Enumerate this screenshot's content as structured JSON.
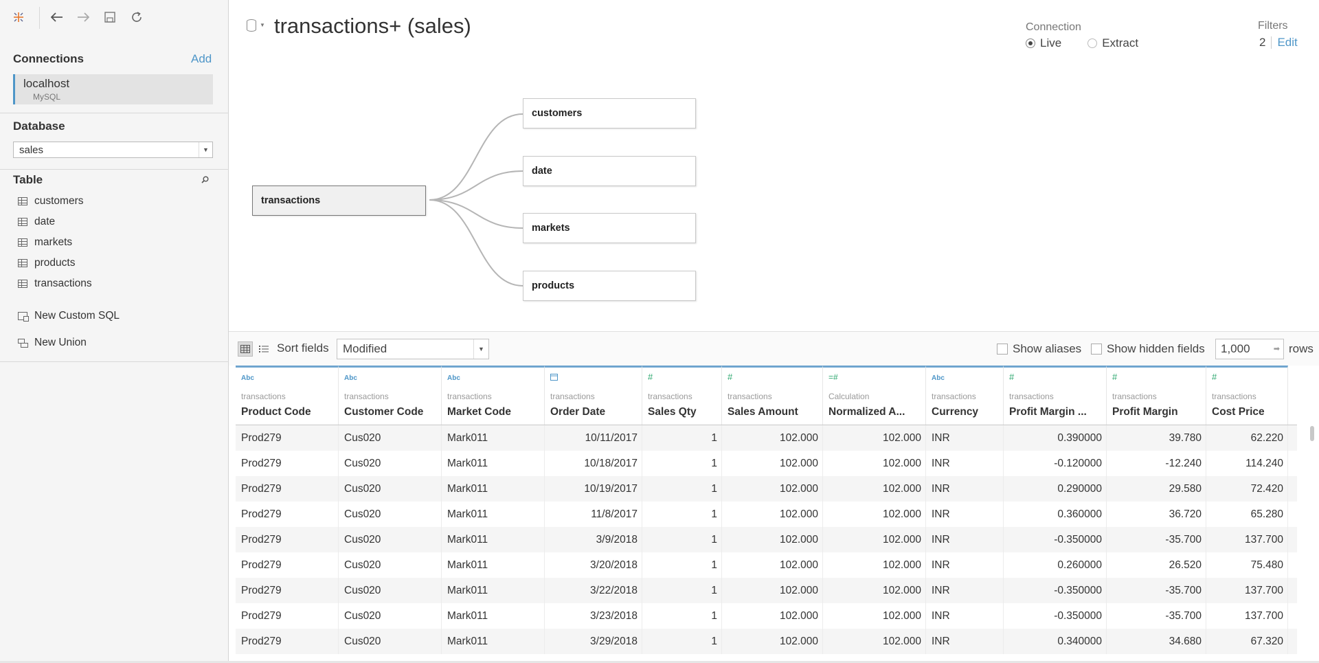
{
  "left": {
    "connections_title": "Connections",
    "add_label": "Add",
    "connection": {
      "name": "localhost",
      "type": "MySQL"
    },
    "database_title": "Database",
    "database_value": "sales",
    "table_title": "Table",
    "tables": [
      "customers",
      "date",
      "markets",
      "products",
      "transactions"
    ],
    "new_custom_sql": "New Custom SQL",
    "new_union": "New Union"
  },
  "header": {
    "datasource_title": "transactions+ (sales)",
    "connection_label": "Connection",
    "live_label": "Live",
    "extract_label": "Extract",
    "selected_connection": "Live",
    "filters_label": "Filters",
    "filters_count": "2",
    "edit_label": "Edit"
  },
  "canvas": {
    "main_table": "transactions",
    "joined_tables": [
      "customers",
      "date",
      "markets",
      "products"
    ]
  },
  "grid_toolbar": {
    "sort_label": "Sort fields",
    "sort_value": "Modified",
    "show_aliases": "Show aliases",
    "show_hidden": "Show hidden fields",
    "rows_value": "1,000",
    "rows_label": "rows"
  },
  "columns": [
    {
      "type": "Abc",
      "type_kind": "str",
      "source": "transactions",
      "name": "Product Code",
      "align": "l"
    },
    {
      "type": "Abc",
      "type_kind": "str",
      "source": "transactions",
      "name": "Customer Code",
      "align": "l"
    },
    {
      "type": "Abc",
      "type_kind": "str",
      "source": "transactions",
      "name": "Market Code",
      "align": "l"
    },
    {
      "type": "calendar",
      "type_kind": "date",
      "source": "transactions",
      "name": "Order Date",
      "align": "r"
    },
    {
      "type": "#",
      "type_kind": "num",
      "source": "transactions",
      "name": "Sales Qty",
      "align": "r"
    },
    {
      "type": "#",
      "type_kind": "num",
      "source": "transactions",
      "name": "Sales Amount",
      "align": "r"
    },
    {
      "type": "=#",
      "type_kind": "cal",
      "source": "Calculation",
      "name": "Normalized A...",
      "align": "r"
    },
    {
      "type": "Abc",
      "type_kind": "str",
      "source": "transactions",
      "name": "Currency",
      "align": "l"
    },
    {
      "type": "#",
      "type_kind": "num",
      "source": "transactions",
      "name": "Profit Margin ...",
      "align": "r"
    },
    {
      "type": "#",
      "type_kind": "num",
      "source": "transactions",
      "name": "Profit Margin",
      "align": "r"
    },
    {
      "type": "#",
      "type_kind": "num",
      "source": "transactions",
      "name": "Cost Price",
      "align": "r"
    }
  ],
  "rows": [
    [
      "Prod279",
      "Cus020",
      "Mark011",
      "10/11/2017",
      "1",
      "102.000",
      "102.000",
      "INR",
      "0.390000",
      "39.780",
      "62.220"
    ],
    [
      "Prod279",
      "Cus020",
      "Mark011",
      "10/18/2017",
      "1",
      "102.000",
      "102.000",
      "INR",
      "-0.120000",
      "-12.240",
      "114.240"
    ],
    [
      "Prod279",
      "Cus020",
      "Mark011",
      "10/19/2017",
      "1",
      "102.000",
      "102.000",
      "INR",
      "0.290000",
      "29.580",
      "72.420"
    ],
    [
      "Prod279",
      "Cus020",
      "Mark011",
      "11/8/2017",
      "1",
      "102.000",
      "102.000",
      "INR",
      "0.360000",
      "36.720",
      "65.280"
    ],
    [
      "Prod279",
      "Cus020",
      "Mark011",
      "3/9/2018",
      "1",
      "102.000",
      "102.000",
      "INR",
      "-0.350000",
      "-35.700",
      "137.700"
    ],
    [
      "Prod279",
      "Cus020",
      "Mark011",
      "3/20/2018",
      "1",
      "102.000",
      "102.000",
      "INR",
      "0.260000",
      "26.520",
      "75.480"
    ],
    [
      "Prod279",
      "Cus020",
      "Mark011",
      "3/22/2018",
      "1",
      "102.000",
      "102.000",
      "INR",
      "-0.350000",
      "-35.700",
      "137.700"
    ],
    [
      "Prod279",
      "Cus020",
      "Mark011",
      "3/23/2018",
      "1",
      "102.000",
      "102.000",
      "INR",
      "-0.350000",
      "-35.700",
      "137.700"
    ],
    [
      "Prod279",
      "Cus020",
      "Mark011",
      "3/29/2018",
      "1",
      "102.000",
      "102.000",
      "INR",
      "0.340000",
      "34.680",
      "67.320"
    ]
  ],
  "colors": {
    "accent": "#4e96c8",
    "numeric_type": "#2fa870",
    "header_rule": "#6fa5cf"
  }
}
